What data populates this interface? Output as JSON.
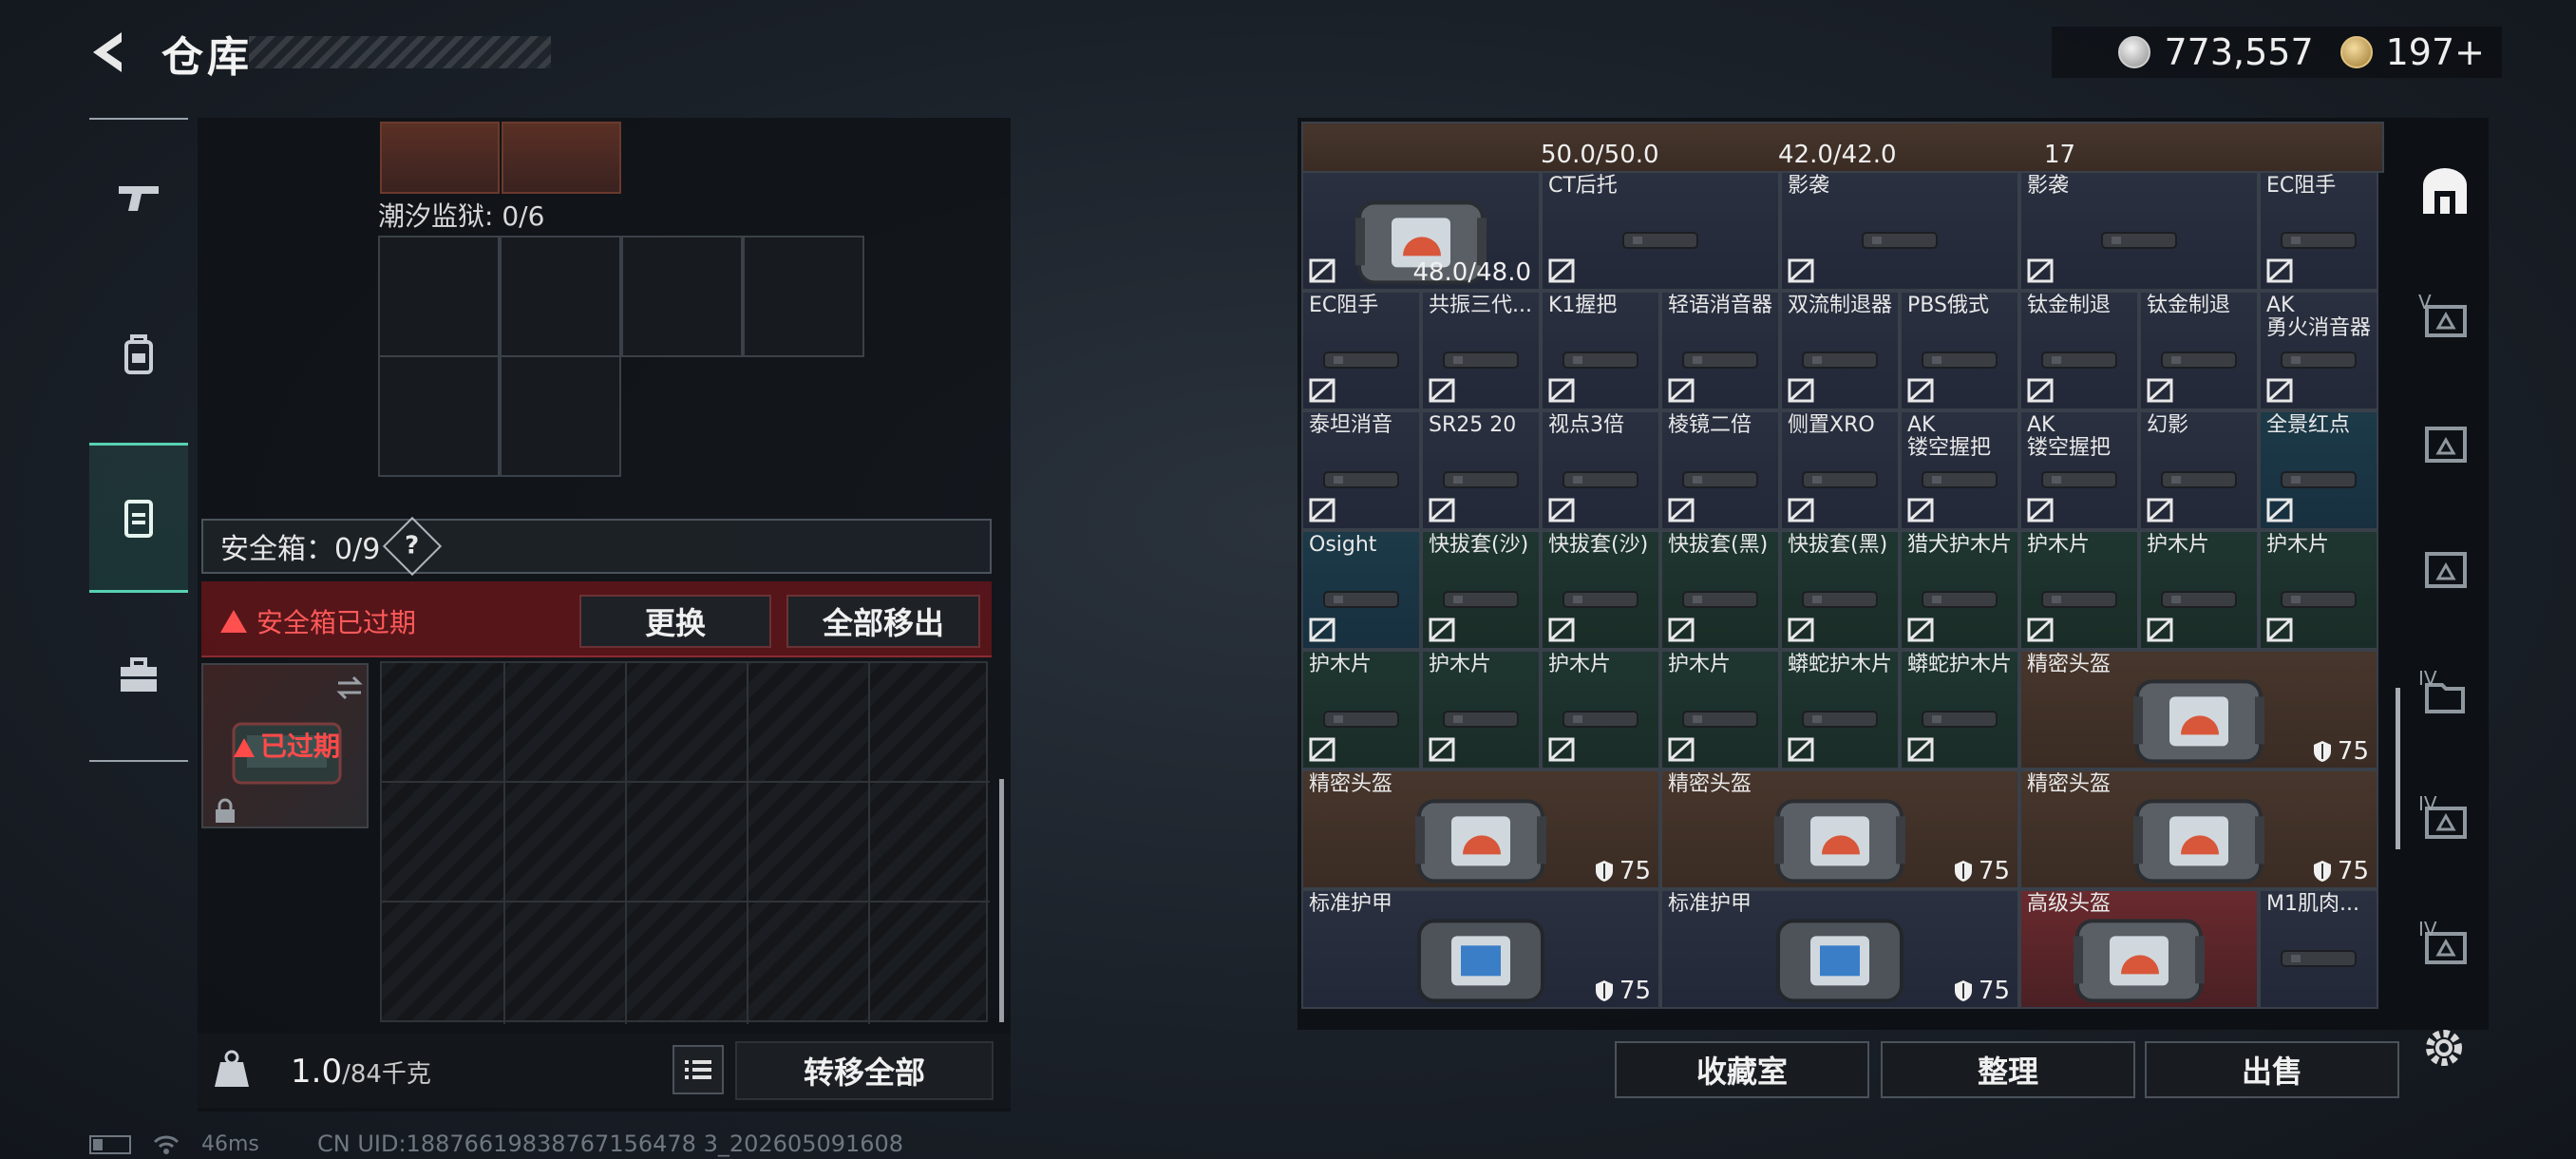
{
  "header": {
    "title": "仓库",
    "currency_silver": "773,557",
    "currency_gold": "197+"
  },
  "left_tabs": [
    "weapons-tab",
    "gear-tab",
    "safebox-tab",
    "tools-tab"
  ],
  "left_panel": {
    "rig_label": "潮汐监狱: 0/6",
    "safe_box_label": "安全箱：0/9",
    "help_badge": "?",
    "expired_warning": "安全箱已过期",
    "replace_button": "更换",
    "move_all_button": "全部移出",
    "case_status": "已过期",
    "weight_value": "1.0",
    "weight_capacity": "/84千克",
    "transfer_all_button": "转移全部"
  },
  "stash": {
    "top_values": [
      "50.0/50.0",
      "42.0/42.0",
      "17"
    ],
    "rows": [
      [
        {
          "name": "",
          "value": "48.0/48.0",
          "color": "blue"
        },
        {
          "name": "CT后托",
          "color": "blue"
        },
        {
          "name": "影袭",
          "color": "blue"
        },
        {
          "name": "影袭",
          "color": "blue"
        },
        {
          "name": "EC阻手",
          "color": "blue"
        }
      ],
      [
        {
          "name": "EC阻手",
          "color": "blue"
        },
        {
          "name": "共振三代...",
          "color": "blue"
        },
        {
          "name": "K1握把",
          "color": "blue"
        },
        {
          "name": "轻语消音器",
          "color": "blue"
        },
        {
          "name": "双流制退器",
          "color": "blue"
        },
        {
          "name": "PBS俄式",
          "color": "blue"
        },
        {
          "name": "钛金制退",
          "color": "blue"
        },
        {
          "name": "钛金制退",
          "color": "blue"
        },
        {
          "name": "AK\n勇火消音器",
          "color": "blue"
        }
      ],
      [
        {
          "name": "泰坦消音",
          "color": "blue"
        },
        {
          "name": "SR25 20",
          "color": "blue"
        },
        {
          "name": "视点3倍",
          "color": "blue"
        },
        {
          "name": "棱镜二倍",
          "color": "blue"
        },
        {
          "name": "侧置XRO",
          "color": "blue"
        },
        {
          "name": "AK\n镂空握把",
          "color": "blue"
        },
        {
          "name": "AK\n镂空握把",
          "color": "blue"
        },
        {
          "name": "幻影",
          "color": "blue"
        },
        {
          "name": "全景红点",
          "color": "teal"
        }
      ],
      [
        {
          "name": "Osight",
          "color": "teal"
        },
        {
          "name": "快拔套(沙)",
          "color": "green"
        },
        {
          "name": "快拔套(沙)",
          "color": "green"
        },
        {
          "name": "快拔套(黑)",
          "color": "green"
        },
        {
          "name": "快拔套(黑)",
          "color": "green"
        },
        {
          "name": "猎犬护木片",
          "color": "green"
        },
        {
          "name": "护木片",
          "color": "green"
        },
        {
          "name": "护木片",
          "color": "green"
        },
        {
          "name": "护木片",
          "color": "green"
        }
      ],
      [
        {
          "name": "护木片",
          "color": "green"
        },
        {
          "name": "护木片",
          "color": "green"
        },
        {
          "name": "护木片",
          "color": "green"
        },
        {
          "name": "护木片",
          "color": "green"
        },
        {
          "name": "蟒蛇护木片",
          "color": "green"
        },
        {
          "name": "蟒蛇护木片",
          "color": "green"
        },
        {
          "name": "精密头盔",
          "value": "75",
          "color": "brown"
        }
      ],
      [
        {
          "name": "精密头盔",
          "value": "75",
          "color": "brown"
        },
        {
          "name": "精密头盔",
          "value": "75",
          "color": "brown"
        },
        {
          "name": "精密头盔",
          "value": "75",
          "color": "brown"
        }
      ],
      [
        {
          "name": "标准护甲",
          "value": "75",
          "color": "blue"
        },
        {
          "name": "标准护甲",
          "value": "75",
          "color": "blue"
        },
        {
          "name": "高级头盔",
          "color": "red"
        },
        {
          "name": "M1肌肉...",
          "color": "blue"
        }
      ]
    ]
  },
  "right_tabs": {
    "levels": [
      "V",
      "IV",
      "IV",
      "IV"
    ]
  },
  "bottom_buttons": {
    "collection": "收藏室",
    "organize": "整理",
    "sell": "出售"
  },
  "status_bar": {
    "ping": "46ms",
    "uid": "CN UID:18876619838767156478 3_202605091608"
  },
  "colors": {
    "accent": "#57d1b4",
    "warning": "#ff5050",
    "cell_blue": "#2a3040",
    "cell_green": "#1f3630",
    "cell_brown": "#47362c",
    "cell_red": "#6a2a2e"
  }
}
